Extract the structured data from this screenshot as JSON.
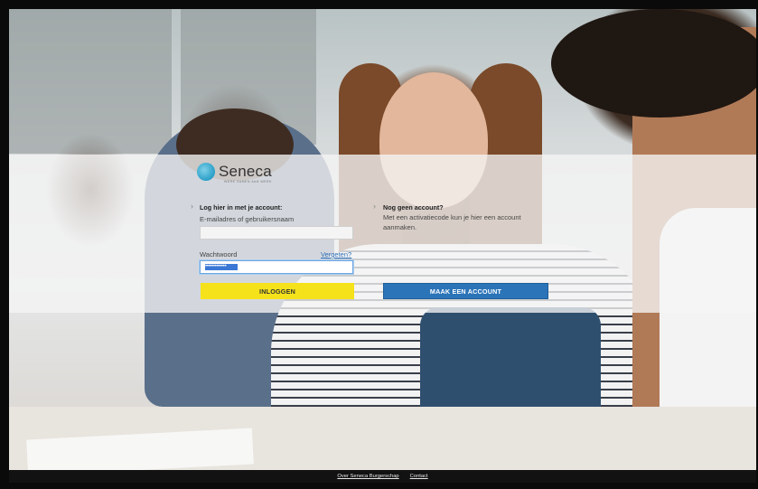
{
  "brand": {
    "name": "Seneca",
    "tagline": "WERK SAMEN AAN WERK"
  },
  "login": {
    "heading": "Log hier in met je account:",
    "email_label": "E-mailadres of gebruikersnaam",
    "email_value": "",
    "password_label": "Wachtwoord",
    "forgot_link": "Vergeten?",
    "password_value": "•••••••••••••",
    "submit_label": "INLOGGEN"
  },
  "register": {
    "heading": "Nog geen account?",
    "description": "Met een activatiecode kun je hier een account aanmaken.",
    "button_label": "MAAK EEN ACCOUNT"
  },
  "footer": {
    "links": [
      "Over Seneca Burgerschap",
      "Contact"
    ]
  },
  "colors": {
    "login_button": "#f5e21a",
    "account_button": "#2b74b8",
    "link": "#2c6fb8"
  },
  "icons": [
    "seneca-logo-icon",
    "chevron-right-icon"
  ]
}
